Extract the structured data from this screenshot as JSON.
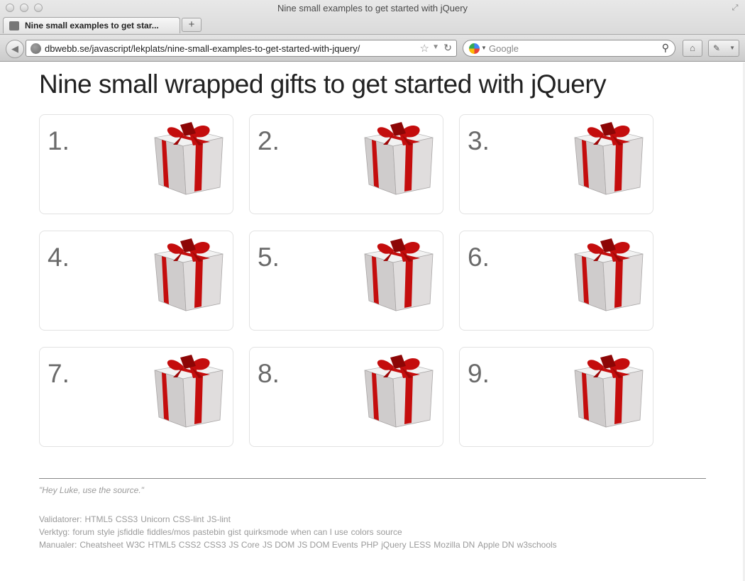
{
  "window": {
    "title": "Nine small examples to get started with jQuery"
  },
  "tab": {
    "label": "Nine small examples to get star..."
  },
  "newtab": {
    "label": "+"
  },
  "navbar": {
    "url": "dbwebb.se/javascript/lekplats/nine-small-examples-to-get-started-with-jquery/",
    "search_placeholder": "Google"
  },
  "page": {
    "heading": "Nine small wrapped gifts to get started with jQuery",
    "cards": [
      {
        "number": "1."
      },
      {
        "number": "2."
      },
      {
        "number": "3."
      },
      {
        "number": "4."
      },
      {
        "number": "5."
      },
      {
        "number": "6."
      },
      {
        "number": "7."
      },
      {
        "number": "8."
      },
      {
        "number": "9."
      }
    ]
  },
  "footer": {
    "quote": "\"Hey Luke, use the source.\"",
    "validators_label": "Validatorer:",
    "validators": [
      "HTML5",
      "CSS3",
      "Unicorn",
      "CSS-lint",
      "JS-lint"
    ],
    "tools_label": "Verktyg:",
    "tools": [
      "forum",
      "style",
      "jsfiddle",
      "fiddles/mos",
      "pastebin",
      "gist",
      "quirksmode",
      "when can I use",
      "colors",
      "source"
    ],
    "manuals_label": "Manualer:",
    "manuals": [
      "Cheatsheet",
      "W3C",
      "HTML5",
      "CSS2",
      "CSS3",
      "JS Core",
      "JS DOM",
      "JS DOM Events",
      "PHP",
      "jQuery",
      "LESS",
      "Mozilla DN",
      "Apple DN",
      "w3schools"
    ]
  },
  "colors": {
    "ribbon": "#c40d0d",
    "box": "#cfcccc",
    "number_text": "#6a6a6a",
    "footer_text": "#9a9a9a"
  },
  "icons": {
    "card_image": "gift-box-icon",
    "back": "back-arrow-icon",
    "site": "globe-icon",
    "bookmark": "star-icon",
    "reload": "reload-icon",
    "search_engine": "google-icon",
    "search": "magnifier-icon",
    "home": "home-icon",
    "tools": "eyedropper-icon"
  }
}
